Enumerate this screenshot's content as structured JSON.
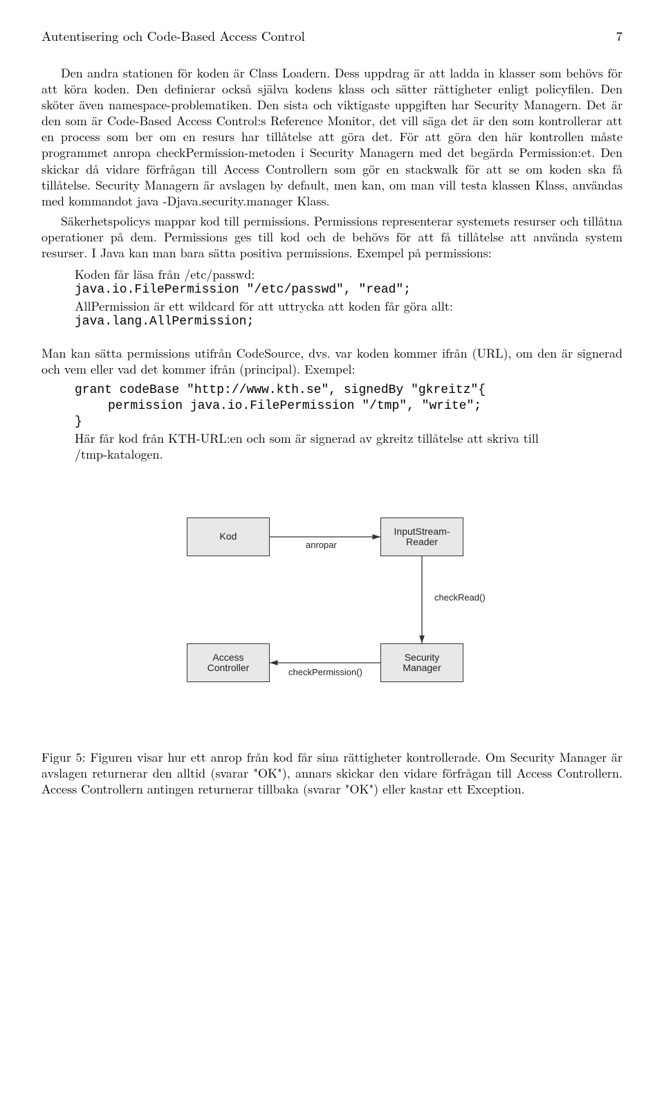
{
  "header": {
    "title": "Autentisering och Code-Based Access Control",
    "page": "7"
  },
  "p1": "Den andra stationen för koden är Class Loadern. Dess uppdrag är att ladda in klasser som behövs för att köra koden. Den definierar också själva kodens klass och sätter rättigheter enligt policyfilen. Den sköter även namespace-problematiken. Den sista och viktigaste uppgiften har Security Managern. Det är den som är Code-Based Access Control:s Reference Monitor, det vill säga det är den som kontrollerar att en process som ber om en resurs har tillåtelse att göra det. För att göra den här kontrollen måste programmet anropa checkPermission-metoden i Security Managern med det begärda Permission:et. Den skickar då vidare förfrågan till Access Controllern som gör en stackwalk för att se om koden ska få tillåtelse. Security Managern är avslagen by default, men kan, om man vill testa klassen Klass, användas med kommandot java -Djava.security.manager Klass.",
  "p2": "Säkerhetspolicys mappar kod till permissions. Permissions representerar systemets resurser och tillåtna operationer på dem. Permissions ges till kod och de behövs för att få tillåtelse att använda system resurser. I Java kan man bara sätta positiva permissions. Exempel på permissions:",
  "block1": {
    "l1": "Koden får läsa från /etc/passwd:",
    "l2": "java.io.FilePermission \"/etc/passwd\", \"read\";",
    "l3": "AllPermission är ett wildcard för att uttrycka att koden får göra allt:",
    "l4": "java.lang.AllPermission;"
  },
  "p3": "Man kan sätta permissions utifrån CodeSource, dvs. var koden kommer ifrån (URL), om den är signerad och vem eller vad det kommer ifrån (principal). Exempel:",
  "block2": {
    "l1": "grant codeBase \"http://www.kth.se\", signedBy \"gkreitz\"{",
    "l2": "permission java.io.FilePermission \"/tmp\", \"write\";",
    "l3": "}",
    "l4": "Här får kod från KTH-URL:en och som är signerad av gkreitz tillåtelse att skriva till /tmp-katalogen."
  },
  "fig": {
    "n1": "Kod",
    "n2": "InputStream-\nReader",
    "n3": "Access\nController",
    "n4": "Security\nManager",
    "e1": "anropar",
    "e2": "checkRead()",
    "e3": "checkPermission()"
  },
  "caption": "Figur 5: Figuren visar hur ett anrop från kod får sina rättigheter kontrollerade. Om Security Manager är avslagen returnerar den alltid (svarar \"OK\"), annars skickar den vidare förfrågan till Access Controllern. Access Controllern antingen returnerar tillbaka (svarar \"OK\") eller kastar ett Exception."
}
